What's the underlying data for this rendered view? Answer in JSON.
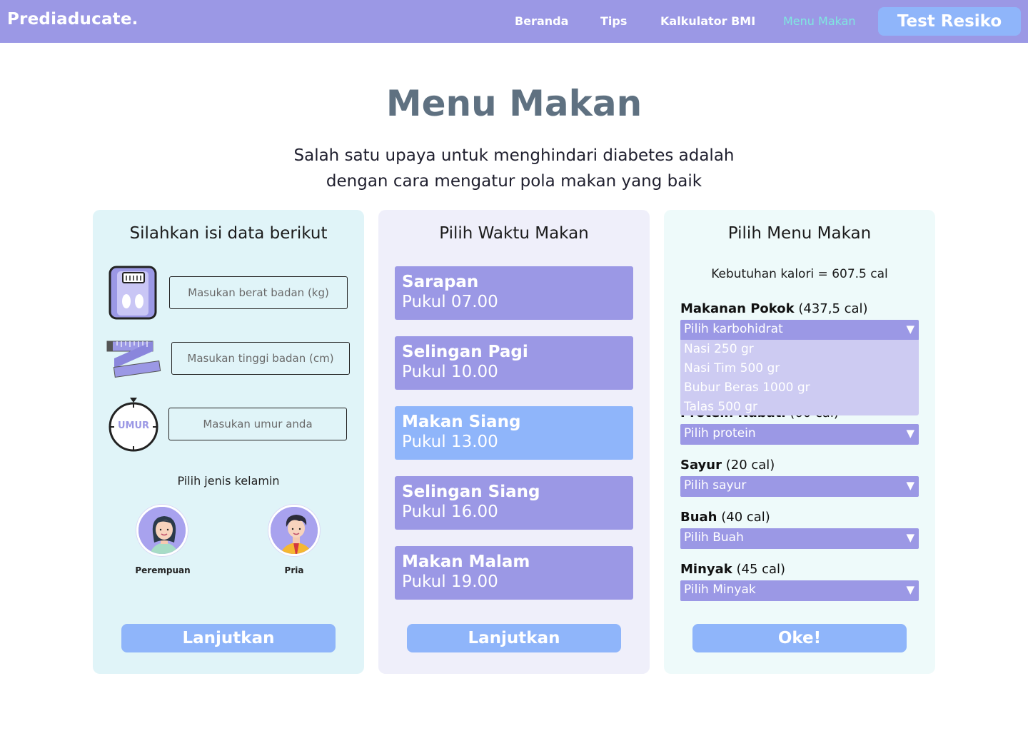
{
  "nav": {
    "brand": "Prediaducate.",
    "links": [
      "Beranda",
      "Tips",
      "Kalkulator BMI",
      "Menu Makan"
    ],
    "cta": "Test Resiko"
  },
  "hero": {
    "title": "Menu Makan",
    "subtitle_line1": "Salah satu upaya untuk menghindari diabetes adalah",
    "subtitle_line2": "dengan cara mengatur pola makan yang baik"
  },
  "panel_data": {
    "title": "Silahkan isi data berikut",
    "weight_placeholder": "Masukan berat badan (kg)",
    "height_placeholder": "Masukan tinggi badan (cm)",
    "age_placeholder": "Masukan umur anda",
    "age_icon_text": "UMUR",
    "gender_label": "Pilih jenis kelamin",
    "female": "Perempuan",
    "male": "Pria",
    "button": "Lanjutkan"
  },
  "panel_time": {
    "title": "Pilih Waktu Makan",
    "meals": [
      {
        "name": "Sarapan",
        "time": "Pukul 07.00"
      },
      {
        "name": "Selingan Pagi",
        "time": "Pukul 10.00"
      },
      {
        "name": "Makan Siang",
        "time": "Pukul 13.00"
      },
      {
        "name": "Selingan Siang",
        "time": "Pukul 16.00"
      },
      {
        "name": "Makan Malam",
        "time": "Pukul 19.00"
      }
    ],
    "button": "Lanjutkan"
  },
  "panel_menu": {
    "title": "Pilih Menu Makan",
    "kcal": "Kebutuhan kalori = 607.5 cal",
    "categories": [
      {
        "name": "Makanan Pokok",
        "cal": "(437,5 cal)",
        "placeholder": "Pilih karbohidrat"
      },
      {
        "name": "Protein Nabati",
        "cal": "(60 cal)",
        "placeholder": "Pilih protein"
      },
      {
        "name": "Sayur",
        "cal": "(20 cal)",
        "placeholder": "Pilih sayur"
      },
      {
        "name": "Buah",
        "cal": "(40 cal)",
        "placeholder": "Pilih Buah"
      },
      {
        "name": "Minyak",
        "cal": "(45 cal)",
        "placeholder": "Pilih Minyak"
      }
    ],
    "dropdown_options": [
      "Nasi 250 gr",
      "Nasi Tim 500 gr",
      "Bubur Beras 1000 gr",
      "Talas 500 gr"
    ],
    "button": "Oke!"
  },
  "colors": {
    "nav_bg": "#9b98e5",
    "cta_bg": "#8fb5fa",
    "active_link": "#7fe7e0",
    "title": "#5f7181",
    "panel1_bg": "#e0f4f8",
    "panel2_bg": "#efeffa",
    "panel3_bg": "#eefafa"
  }
}
